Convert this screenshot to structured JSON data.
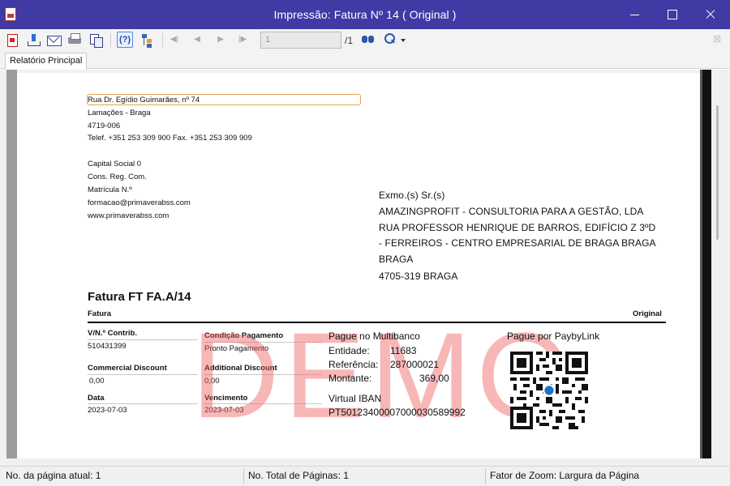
{
  "window": {
    "title": "Impressão: Fatura Nº 14  ( Original )"
  },
  "toolbar": {
    "page_input_value": "1",
    "page_total": "/1"
  },
  "tabs": [
    {
      "label": "Relatório Principal"
    }
  ],
  "company": {
    "address_line1": "Rua Dr. Egídio Guimarães, nº 74",
    "address_line2": "Lamações - Braga",
    "postal_code": "4719-006",
    "phone_fax": "Telef. +351 253 309 900  Fax. +351 253 309 909",
    "capital_social": "Capital Social  0",
    "cons_reg": "Cons. Reg. Com.",
    "matricula": "Matrícula N.º",
    "email": "formacao@primaverabss.com",
    "website": "www.primaverabss.com"
  },
  "recipient": {
    "greeting": "Exmo.(s) Sr.(s)",
    "name": "AMAZINGPROFIT - CONSULTORIA PARA A GESTÃO, LDA",
    "street_line1": "RUA PROFESSOR HENRIQUE DE BARROS, EDIFÍCIO Z 3ºD",
    "street_line2": "- FERREIROS - CENTRO EMPRESARIAL DE BRAGA BRAGA",
    "city": "BRAGA",
    "postal": " 4705-319 BRAGA"
  },
  "document": {
    "title": "Fatura FT FA.A/14",
    "type_label": "Fatura",
    "copy_label": "Original"
  },
  "fields": {
    "vat_label": "V/N.º Contrib.",
    "vat_value": "510431399",
    "payment_condition_label": "Condição Pagamento",
    "payment_condition_value": "Pronto Pagamento",
    "commercial_discount_label": "Commercial Discount",
    "commercial_discount_value": "0,00",
    "additional_discount_label": "Additional Discount",
    "additional_discount_value": " 0,00",
    "date_label": "Data",
    "date_value": "2023-07-03",
    "due_label": "Vencimento",
    "due_value": "2023-07-03"
  },
  "multibanco": {
    "heading": "Pague no Multibanco",
    "entidade_label": "Entidade:",
    "entidade_value": "11683",
    "referencia_label": "Referência:",
    "referencia_value": "287000021",
    "montante_label": "Montante:",
    "montante_value": "369,00",
    "iban_label": "Virtual IBAN",
    "iban_value": "PT50123400007000030589992"
  },
  "paybylink": {
    "heading": "Pague por PaybyLink"
  },
  "watermark": "DEMO",
  "statusbar": {
    "current_page": "No. da página atual: 1",
    "total_pages": "No. Total de Páginas: 1",
    "zoom_factor": "Fator de Zoom: Largura da Página"
  },
  "colors": {
    "titlebar": "#3f3aa4",
    "watermark": "#f05f5f",
    "address_highlight": "#e0a74f"
  },
  "icons": [
    "app-document-icon",
    "pdf-export-icon",
    "export-icon",
    "email-icon",
    "print-icon",
    "copy-icon",
    "help-icon",
    "tree-view-icon",
    "first-page-icon",
    "previous-page-icon",
    "next-page-icon",
    "last-page-icon",
    "find-icon",
    "zoom-icon",
    "close-report-icon",
    "qr-code"
  ]
}
